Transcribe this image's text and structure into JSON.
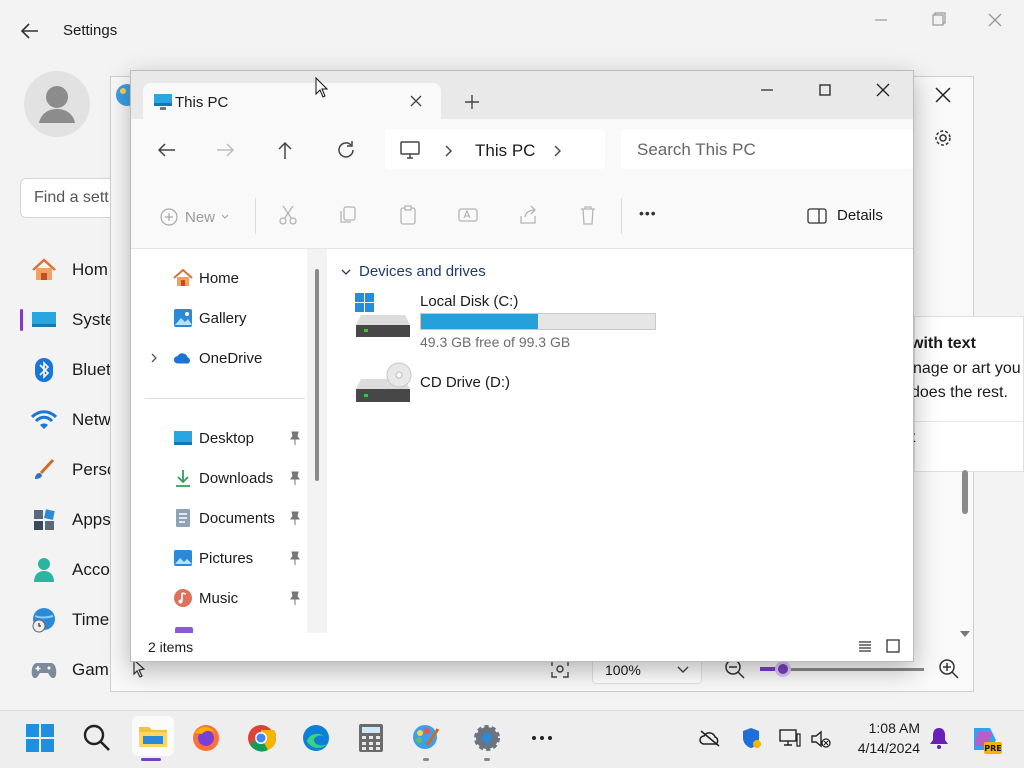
{
  "settings": {
    "title": "Settings",
    "search_placeholder": "Find a sett",
    "nav": [
      {
        "label": "Hom",
        "icon": "home-icon"
      },
      {
        "label": "Syste",
        "icon": "system-icon"
      },
      {
        "label": "Bluet",
        "icon": "bluetooth-icon"
      },
      {
        "label": "Netw",
        "icon": "wifi-icon"
      },
      {
        "label": "Perso",
        "icon": "brush-icon"
      },
      {
        "label": "Apps",
        "icon": "apps-icon"
      },
      {
        "label": "Acco",
        "icon": "account-icon"
      },
      {
        "label": "Time",
        "icon": "globe-clock-icon"
      },
      {
        "label": "Gam",
        "icon": "gamepad-icon"
      }
    ]
  },
  "paint": {
    "popup_title": "with text",
    "popup_line1": "nage or art you",
    "popup_line2": "does the rest.",
    "popup_line3": "t",
    "zoom": "100%"
  },
  "explorer": {
    "tab_title": "This PC",
    "breadcrumb": "This PC",
    "search_placeholder": "Search This PC",
    "new_label": "New",
    "more_label": "•••",
    "details_label": "Details",
    "nav": [
      {
        "label": "Home",
        "icon": "home-icon"
      },
      {
        "label": "Gallery",
        "icon": "gallery-icon"
      },
      {
        "label": "OneDrive",
        "icon": "onedrive-icon"
      },
      {
        "label": "Desktop",
        "icon": "desktop-folder-icon"
      },
      {
        "label": "Downloads",
        "icon": "download-icon"
      },
      {
        "label": "Documents",
        "icon": "documents-icon"
      },
      {
        "label": "Pictures",
        "icon": "pictures-icon"
      },
      {
        "label": "Music",
        "icon": "music-icon"
      }
    ],
    "group_header": "Devices and drives",
    "drives": [
      {
        "name": "Local Disk (C:)",
        "free_text": "49.3 GB free of 99.3 GB",
        "used_fraction": 0.5
      },
      {
        "name": "CD Drive (D:)"
      }
    ],
    "status": "2 items",
    "accent": "#26a0da"
  },
  "taskbar": {
    "time": "1:08 AM",
    "date": "4/14/2024"
  }
}
